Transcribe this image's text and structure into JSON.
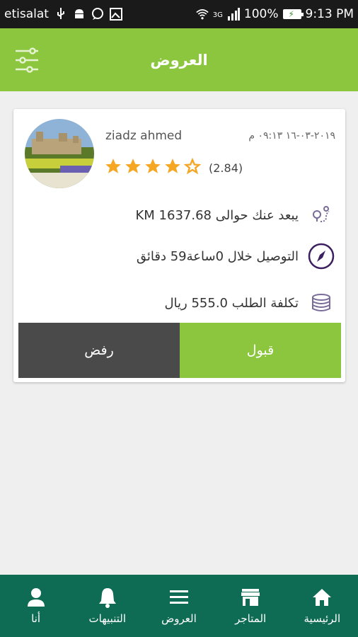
{
  "status_bar": {
    "carrier": "etisalat",
    "network": "3G",
    "battery": "100%",
    "time": "9:13 PM"
  },
  "app_bar": {
    "title": "العروض"
  },
  "offer": {
    "user_name": "ziadz ahmed",
    "date": "٢٠١٩-٠٣-١٦ ٠٩:١٣ م",
    "rating_stars": 4,
    "rating_text": "(2.84)",
    "distance_text": "يبعد عنك حوالى KM 1637.68",
    "delivery_text": "التوصيل خلال 0ساعة59 دقائق",
    "cost_text": "تكلفة الطلب 555.0 ريال",
    "accept_label": "قبول",
    "reject_label": "رفض"
  },
  "bottom_nav": {
    "items": [
      {
        "label": "أنا",
        "icon": "person-icon"
      },
      {
        "label": "التنبيهات",
        "icon": "bell-icon"
      },
      {
        "label": "العروض",
        "icon": "menu-icon"
      },
      {
        "label": "المتاجر",
        "icon": "store-icon"
      },
      {
        "label": "الرئيسية",
        "icon": "home-icon"
      }
    ]
  },
  "colors": {
    "primary": "#8cc63f",
    "nav": "#0e6b54",
    "reject": "#4a4a4a",
    "star": "#f5a623"
  }
}
